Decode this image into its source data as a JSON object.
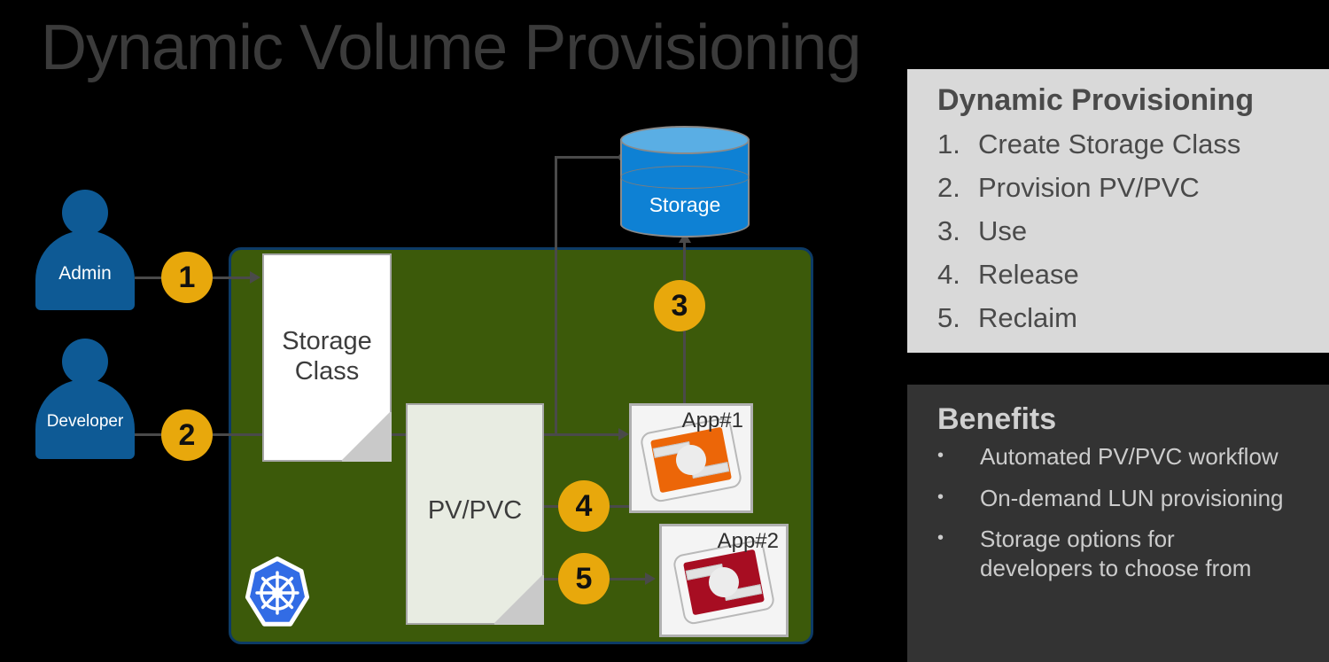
{
  "title": "Dynamic Volume Provisioning",
  "colors": {
    "background": "#000000",
    "title_text": "#3b3b3b",
    "cluster_panel_fill": "#3c5a0a",
    "cluster_panel_border": "#0d3b66",
    "persona_fill": "#0e5a95",
    "step_badge_fill": "#e8a80c",
    "storage_cylinder_fill": "#0e81d4",
    "storage_cylinder_top": "#5aaee4",
    "app1_accent": "#ec6608",
    "app2_accent": "#a70d22",
    "kubernetes_blue": "#326ce5",
    "panel_light_bg": "#d9d9d9",
    "panel_dark_bg": "#333333",
    "connector": "#4a4a4a"
  },
  "personas": [
    {
      "id": "admin",
      "label": "Admin"
    },
    {
      "id": "developer",
      "label": "Developer"
    }
  ],
  "steps": [
    {
      "number": "1"
    },
    {
      "number": "2"
    },
    {
      "number": "3"
    },
    {
      "number": "4"
    },
    {
      "number": "5"
    }
  ],
  "documents": [
    {
      "id": "storage-class",
      "label": "Storage\nClass"
    },
    {
      "id": "pv-pvc",
      "label": "PV/PVC"
    }
  ],
  "storage": {
    "label": "Storage"
  },
  "apps": [
    {
      "id": "app1",
      "label": "App#1"
    },
    {
      "id": "app2",
      "label": "App#2"
    }
  ],
  "kubernetes": {
    "icon": "kubernetes-helm-icon"
  },
  "panels": {
    "dynamic": {
      "heading": "Dynamic Provisioning",
      "items": [
        {
          "marker": "1.",
          "text": "Create Storage Class"
        },
        {
          "marker": "2.",
          "text": "Provision PV/PVC"
        },
        {
          "marker": "3.",
          "text": "Use"
        },
        {
          "marker": "4.",
          "text": "Release"
        },
        {
          "marker": "5.",
          "text": "Reclaim"
        }
      ]
    },
    "benefits": {
      "heading": "Benefits",
      "items": [
        {
          "marker": "•",
          "text": "Automated PV/PVC workflow"
        },
        {
          "marker": "•",
          "text": "On-demand LUN provisioning"
        },
        {
          "marker": "•",
          "text": "Storage options for developers to choose from"
        }
      ]
    }
  }
}
